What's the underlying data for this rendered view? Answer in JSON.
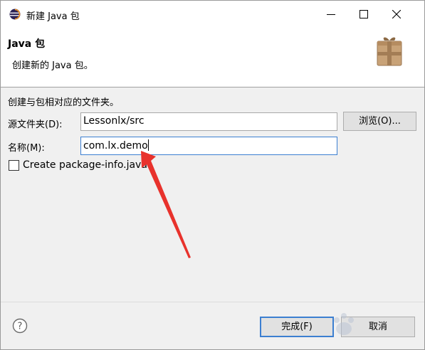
{
  "window": {
    "title": "新建 Java 包",
    "icon": "eclipse-icon",
    "controls": [
      "minimize-icon",
      "maximize-icon",
      "close-icon"
    ]
  },
  "header": {
    "title": "Java 包",
    "description": "创建新的 Java 包。",
    "icon": "package-icon"
  },
  "form": {
    "section_description": "创建与包相对应的文件夹。",
    "source_folder_label": "源文件夹(D):",
    "source_folder_value": "Lessonlx/src",
    "browse_label": "浏览(O)...",
    "name_label": "名称(M):",
    "name_value": "com.lx.demo",
    "package_info_label": "Create package-info.java",
    "package_info_checked": false
  },
  "footer": {
    "help_icon": "help-icon",
    "finish_label": "完成(F)",
    "cancel_label": "取消"
  },
  "colors": {
    "focus_blue": "#3c7fd1",
    "annotation_red": "#e8322c",
    "button_bg": "#e1e1e1",
    "dialog_bg": "#f0f0f0"
  }
}
